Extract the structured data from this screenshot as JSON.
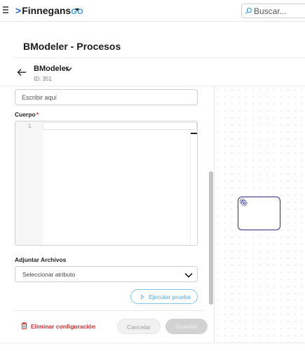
{
  "topbar": {
    "brand_name": "Finnegans",
    "brand_suffix": "GO",
    "search_placeholder": "Buscar..."
  },
  "page": {
    "title": "BModeler - Procesos"
  },
  "header": {
    "model_name": "BModeler",
    "model_id": "ID: 351"
  },
  "form": {
    "input_placeholder": "Escribir aquí",
    "body_label": "Cuerpo",
    "required_mark": "*",
    "editor_line_number": "1",
    "attachments_label": "Adjuntar Archivos",
    "attachments_select_value": "Seleccionar atributo",
    "run_test_label": "Ejecutar prueba"
  },
  "footer": {
    "delete_label": "Eliminar configuración",
    "cancel_label": "Cancelar",
    "save_label": "Guardar"
  },
  "colors": {
    "accent_blue": "#1e66c6",
    "danger_red": "#d32f2f",
    "node_border": "#2d2e8a",
    "run_button": "#7fc6ea"
  }
}
